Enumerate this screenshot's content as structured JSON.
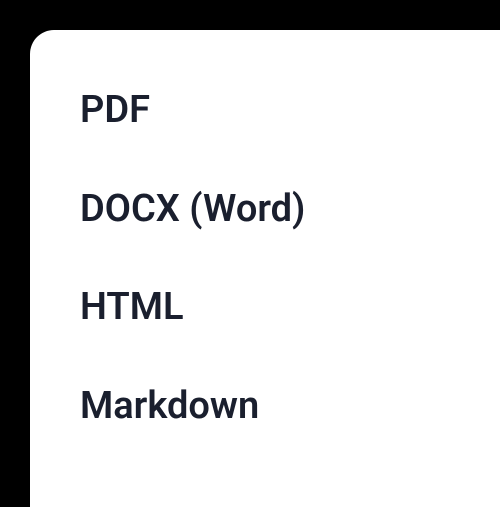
{
  "menu": {
    "items": [
      {
        "label": "PDF"
      },
      {
        "label": "DOCX (Word)"
      },
      {
        "label": "HTML"
      },
      {
        "label": "Markdown"
      }
    ]
  }
}
